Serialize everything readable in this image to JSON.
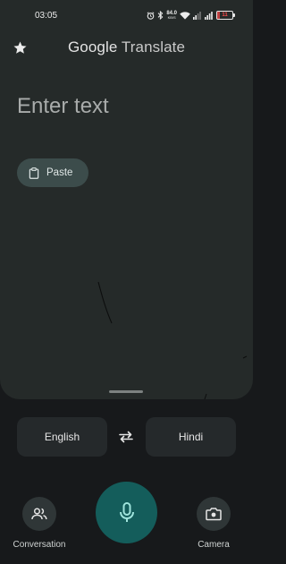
{
  "status_bar": {
    "time": "03:05",
    "network_speed": "84.0",
    "network_speed_unit": "KB/S",
    "battery_level": "11",
    "icons": [
      "alarm-icon",
      "bluetooth-icon",
      "wifi-icon",
      "signal-5g-icon",
      "signal-icon",
      "battery-icon"
    ]
  },
  "header": {
    "brand": "Google",
    "product": "Translate",
    "star_icon": "star-icon"
  },
  "input": {
    "placeholder": "Enter text",
    "paste_label": "Paste",
    "paste_icon": "clipboard-icon"
  },
  "languages": {
    "source": "English",
    "target": "Hindi",
    "swap_icon": "swap-arrows-icon"
  },
  "actions": {
    "conversation_label": "Conversation",
    "conversation_icon": "people-icon",
    "mic_icon": "microphone-icon",
    "camera_label": "Camera",
    "camera_icon": "camera-icon"
  },
  "colors": {
    "card_background": "#252a29",
    "page_background": "#17191b",
    "paste_chip": "#3c4c4b",
    "mic_button": "#145d5b",
    "battery_low": "#ff4b4b"
  }
}
